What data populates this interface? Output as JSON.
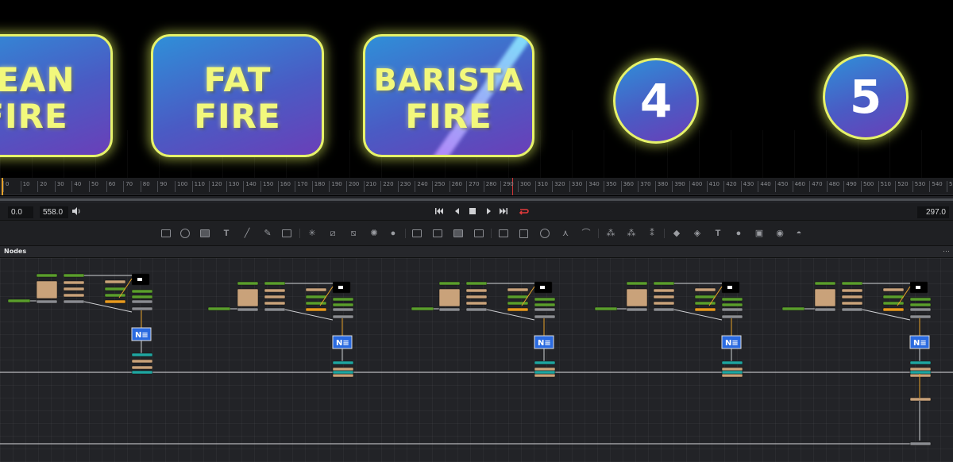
{
  "viewer": {
    "cards": [
      {
        "line1": "LEAN",
        "line2": "FIRE"
      },
      {
        "line1": "FAT",
        "line2": "FIRE"
      },
      {
        "line1": "BARISTA",
        "line2": "FIRE"
      }
    ],
    "numbers": [
      "4",
      "5"
    ]
  },
  "timeline": {
    "ticks": [
      "0",
      "10",
      "20",
      "30",
      "40",
      "50",
      "60",
      "70",
      "80",
      "90",
      "100",
      "110",
      "120",
      "130",
      "140",
      "150",
      "160",
      "170",
      "180",
      "190",
      "200",
      "210",
      "220",
      "230",
      "240",
      "250",
      "260",
      "270",
      "280",
      "290",
      "300",
      "310",
      "320",
      "330",
      "340",
      "350",
      "360",
      "370",
      "380",
      "390",
      "400",
      "410",
      "420",
      "430",
      "440",
      "450",
      "460",
      "470",
      "480",
      "490",
      "500",
      "510",
      "520",
      "530",
      "540",
      "550"
    ],
    "playhead_frame": 297
  },
  "transport": {
    "start": "0.0",
    "end": "558.0",
    "current": "297.0"
  },
  "nodes_panel": {
    "title": "Nodes",
    "menu_icon": "more-dots-icon"
  },
  "colors": {
    "accent_yellow": "#e6f26a",
    "playhead": "#d23535",
    "node_green": "#5a9e2c",
    "node_tan": "#c9a27a",
    "node_orange": "#e89a1f",
    "node_teal": "#1fa5a0",
    "node_blue": "#2a6ae0"
  }
}
